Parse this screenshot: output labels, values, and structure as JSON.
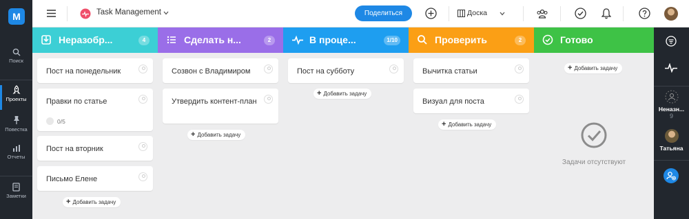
{
  "sidebar": {
    "logo": "M",
    "items": [
      {
        "label": "Поиск",
        "icon": "search-icon"
      },
      {
        "label": "Проекты",
        "icon": "rocket-icon",
        "active": true
      },
      {
        "label": "Повестка",
        "icon": "pin-icon"
      },
      {
        "label": "Отчеты",
        "icon": "bar-chart-icon"
      },
      {
        "label": "Заметки",
        "icon": "notes-icon"
      }
    ]
  },
  "topbar": {
    "project_title": "Task Management",
    "share_label": "Поделиться",
    "view_label": "Доска",
    "icons": [
      "menu-icon",
      "heartbeat-icon",
      "chevron-down-icon",
      "add-icon",
      "board-icon",
      "team-icon",
      "check-circle-icon",
      "bell-icon",
      "help-icon"
    ]
  },
  "columns": [
    {
      "title": "Неразобр...",
      "count": "4",
      "color": "#3ccfd5",
      "icon": "inbox-icon",
      "cards": [
        {
          "text": "Пост на понедельник"
        },
        {
          "text": "Правки по статье",
          "checklist": "0/5"
        },
        {
          "text": "Пост на вторник"
        },
        {
          "text": "Письмо Елене"
        }
      ],
      "add_label": "Добавить задачу"
    },
    {
      "title": "Сделать н...",
      "count": "2",
      "color": "#9a6ee8",
      "icon": "list-icon",
      "cards": [
        {
          "text": "Созвон с Владимиром"
        },
        {
          "text": "Утвердить контент-план"
        }
      ],
      "add_label": "Добавить задачу"
    },
    {
      "title": "В проце...",
      "count": "1/10",
      "color": "#1e9ef0",
      "icon": "pulse-icon",
      "cards": [
        {
          "text": "Пост на субботу"
        }
      ],
      "add_label": "Добавить задачу"
    },
    {
      "title": "Проверить",
      "count": "2",
      "color": "#fb9f15",
      "icon": "search-icon",
      "cards": [
        {
          "text": "Вычитка статьи"
        },
        {
          "text": "Визуал для поста"
        }
      ],
      "add_label": "Добавить задачу"
    },
    {
      "title": "Готово",
      "count": "",
      "color": "#3ec246",
      "icon": "check-circle-icon",
      "cards": [],
      "add_label": "Добавить задачу",
      "empty_text": "Задачи отсутствуют"
    }
  ],
  "right_panel": {
    "icons": [
      "filter-icon",
      "activity-icon",
      "add-user-icon"
    ],
    "members": [
      {
        "name": "Неназн...",
        "count": "9"
      },
      {
        "name": "Татьяна"
      }
    ]
  }
}
